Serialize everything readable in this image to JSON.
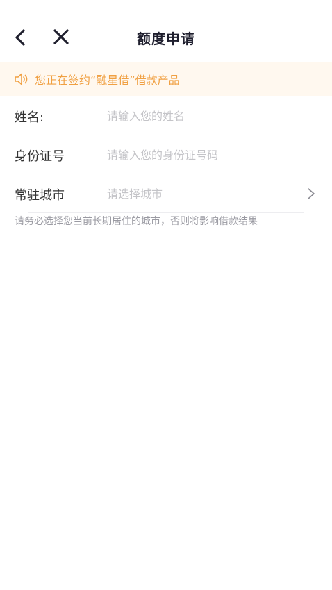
{
  "header": {
    "title": "额度申请",
    "back_icon": "chevron-left-icon",
    "close_icon": "close-icon"
  },
  "notice": {
    "icon": "speaker-icon",
    "text": "您正在签约“融星借”借款产品",
    "color": "#f0a042",
    "background": "#fff8ef"
  },
  "form": {
    "name": {
      "label": "姓名:",
      "value": "",
      "placeholder": "请输入您的姓名"
    },
    "id_number": {
      "label": "身份证号",
      "value": "",
      "placeholder": "请输入您的身份证号码"
    },
    "city": {
      "label": "常驻城市",
      "value": "",
      "placeholder": "请选择城市",
      "icon": "chevron-right-icon"
    },
    "hint": "请务必选择您当前长期居住的城市，否则将影响借款结果"
  }
}
